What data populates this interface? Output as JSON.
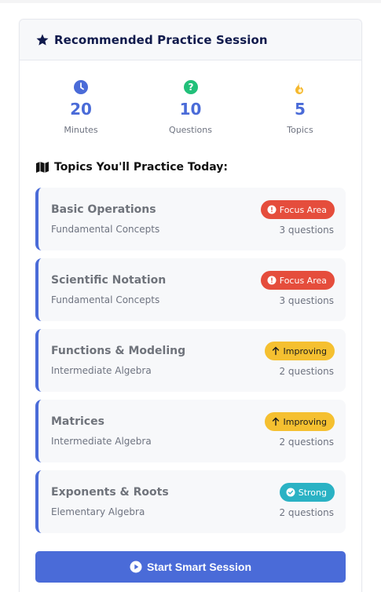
{
  "header": {
    "title": "Recommended Practice Session",
    "icon": "star-icon"
  },
  "stats": [
    {
      "value": "20",
      "label": "Minutes",
      "icon": "clock-icon",
      "color": "#4a6bd8"
    },
    {
      "value": "10",
      "label": "Questions",
      "icon": "question-icon",
      "color": "#22c07a"
    },
    {
      "value": "5",
      "label": "Topics",
      "icon": "fire-icon",
      "color": "#f5b82e"
    }
  ],
  "topics_section": {
    "title": "Topics You'll Practice Today:",
    "icon": "map-icon"
  },
  "topics": [
    {
      "name": "Basic Operations",
      "category": "Fundamental Concepts",
      "count": "3 questions",
      "badge": "Focus Area",
      "badge_type": "focus"
    },
    {
      "name": "Scientific Notation",
      "category": "Fundamental Concepts",
      "count": "3 questions",
      "badge": "Focus Area",
      "badge_type": "focus"
    },
    {
      "name": "Functions & Modeling",
      "category": "Intermediate Algebra",
      "count": "2 questions",
      "badge": "Improving",
      "badge_type": "improving"
    },
    {
      "name": "Matrices",
      "category": "Intermediate Algebra",
      "count": "2 questions",
      "badge": "Improving",
      "badge_type": "improving"
    },
    {
      "name": "Exponents & Roots",
      "category": "Elementary Algebra",
      "count": "2 questions",
      "badge": "Strong",
      "badge_type": "strong"
    }
  ],
  "cta": {
    "label": "Start Smart Session",
    "icon": "play-circle-icon"
  },
  "colors": {
    "accent": "#4a6bd8",
    "focus": "#e54d3c",
    "improving": "#f5c030",
    "strong": "#2ab2c4",
    "header_text": "#101a4c"
  }
}
